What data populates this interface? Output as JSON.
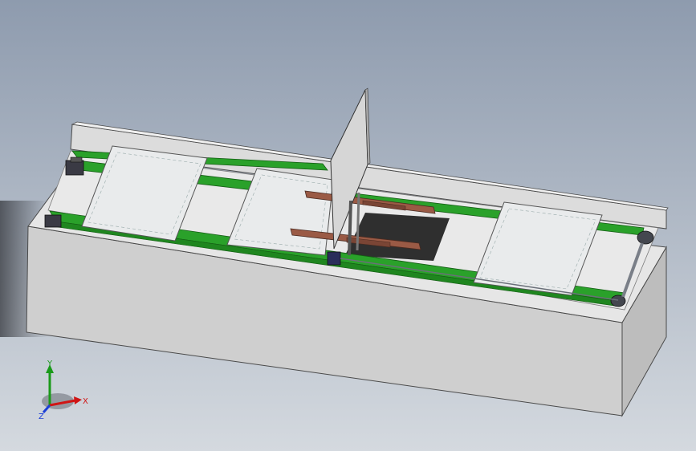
{
  "scene": {
    "background_top": "#8e9bae",
    "background_bottom": "#d4d9df",
    "base_front_color": "#cfcfcf",
    "base_side_color": "#bdbdbd",
    "base_top_color": "#e6e6e6",
    "belt_color": "#2aa12a",
    "plate_color": "#e9ebec",
    "bracket_color": "#9a5a45",
    "parts": [
      "conveyor-base",
      "conveyor-belt",
      "product-plate",
      "transfer-gate",
      "motor-unit",
      "drive-shaft",
      "roller-wheel"
    ]
  },
  "triad": {
    "x_label": "X",
    "y_label": "Y",
    "z_label": "Z",
    "x_color": "#d01515",
    "y_color": "#1a9a1a",
    "z_color": "#1c3fd6"
  }
}
